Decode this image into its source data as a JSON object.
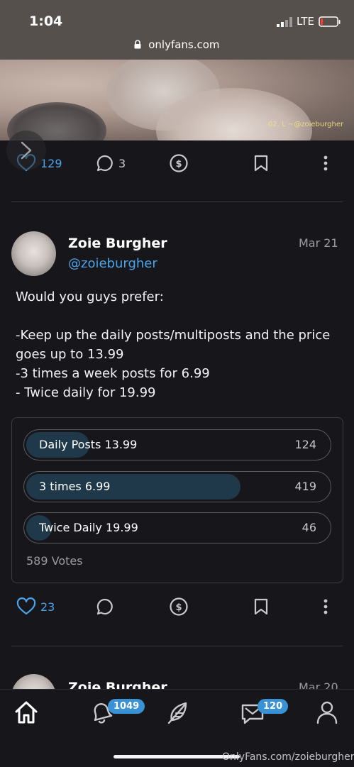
{
  "status_bar": {
    "time": "1:04",
    "carrier": "LTE",
    "url": "onlyfans.com"
  },
  "media": {
    "watermark": "02. L ~@zoieburgher"
  },
  "post1_actions": {
    "likes": "129",
    "comments": "3"
  },
  "post2": {
    "author_name": "Zoie Burgher",
    "handle": "@zoieburgher",
    "date": "Mar 21",
    "text_lines": [
      "Would you guys prefer:",
      "",
      "-Keep up the daily posts/multiposts and the price",
      "goes up to 13.99",
      "-3 times a week posts for 6.99",
      "- Twice daily for 19.99"
    ],
    "poll": {
      "options": [
        {
          "label": "Daily Posts 13.99",
          "count": "124",
          "percent": 21
        },
        {
          "label": "3 times 6.99",
          "count": "419",
          "percent": 71
        },
        {
          "label": "Twice Daily 19.99",
          "count": "46",
          "percent": 8
        }
      ],
      "total_votes": "589 Votes"
    },
    "likes": "23"
  },
  "post3": {
    "author_name": "Zoie Burgher",
    "date": "Mar 20"
  },
  "bottom_nav": {
    "items": [
      "home-icon",
      "notifications-icon",
      "feather-icon",
      "messages-icon",
      "profile-icon"
    ],
    "notifications_badge": "1049",
    "messages_badge": "120"
  },
  "footer_watermark": "OnlyFans.com/zoieburgher",
  "colors": {
    "accent": "#4aa3e8",
    "background": "#17171b",
    "poll_fill": "#20394a"
  }
}
